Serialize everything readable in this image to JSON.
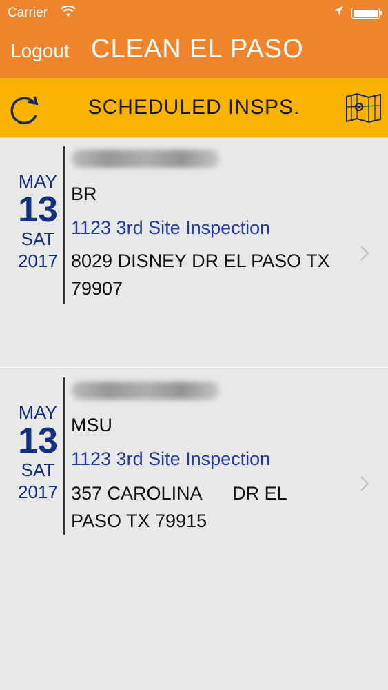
{
  "status_bar": {
    "carrier": "Carrier",
    "time": ""
  },
  "header": {
    "logout_label": "Logout",
    "title": "CLEAN EL PASO"
  },
  "subheader": {
    "title": "SCHEDULED INSPS."
  },
  "inspections": [
    {
      "month": "MAY",
      "day": "13",
      "weekday": "SAT",
      "year": "2017",
      "code": "BR",
      "inspection_type": "1123 3rd Site Inspection",
      "address": "8029 DISNEY DR EL PASO TX\n79907"
    },
    {
      "month": "MAY",
      "day": "13",
      "weekday": "SAT",
      "year": "2017",
      "code": "MSU",
      "inspection_type": "1123 3rd Site Inspection",
      "address": "357 CAROLINA      DR EL\nPASO TX 79915"
    }
  ],
  "colors": {
    "nav": "#ef842c",
    "subbar": "#f7b300",
    "date_text": "#12307e",
    "link": "#1f3aa6"
  },
  "icons": {
    "refresh": "refresh-icon",
    "map": "map-icon",
    "chevron": "chevron-right-icon"
  }
}
